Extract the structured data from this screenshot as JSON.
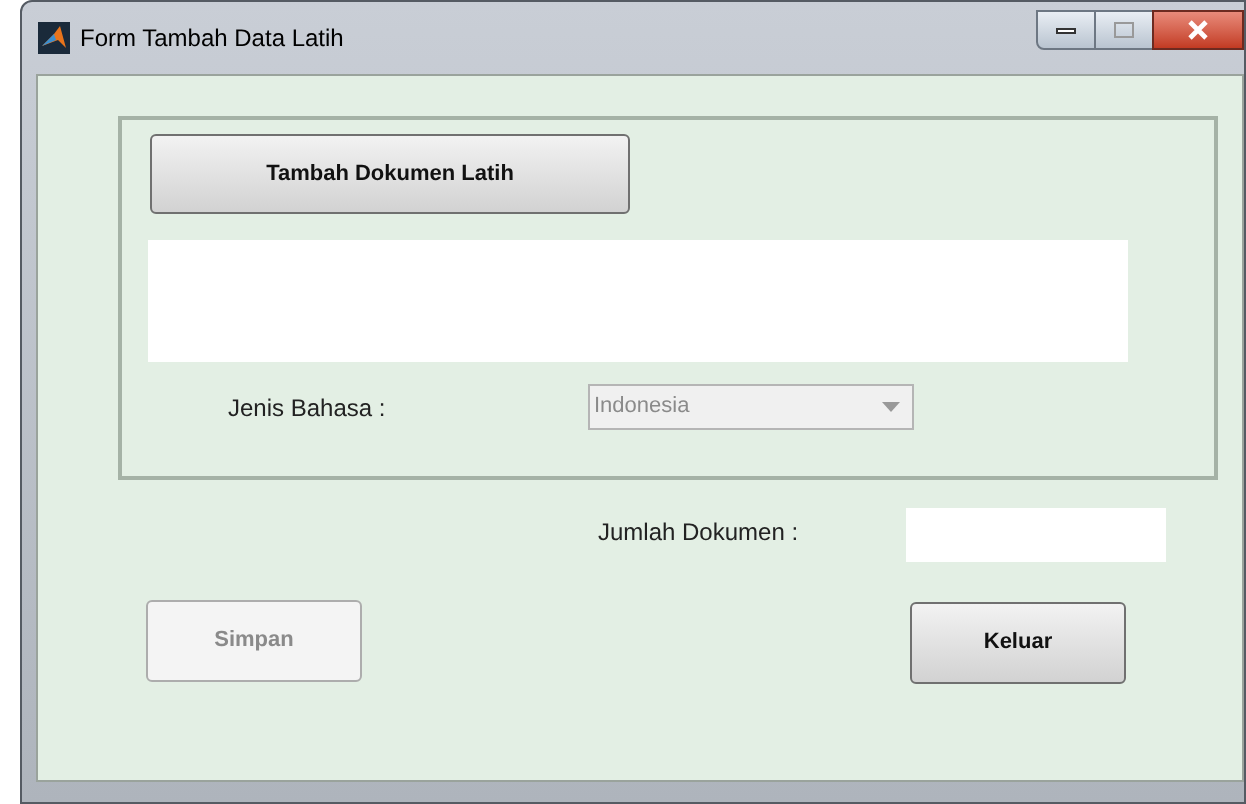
{
  "window": {
    "title": "Form Tambah Data Latih"
  },
  "panel": {
    "add_button": {
      "label": "Tambah Dokumen Latih",
      "disabled": false
    },
    "language_label": "Jenis Bahasa :",
    "language_dropdown": {
      "value": "Indonesia",
      "disabled": true
    }
  },
  "count_label": "Jumlah Dokumen :",
  "buttons": [
    {
      "label": "Simpan",
      "disabled": true
    },
    {
      "label": "Keluar",
      "disabled": false
    }
  ]
}
